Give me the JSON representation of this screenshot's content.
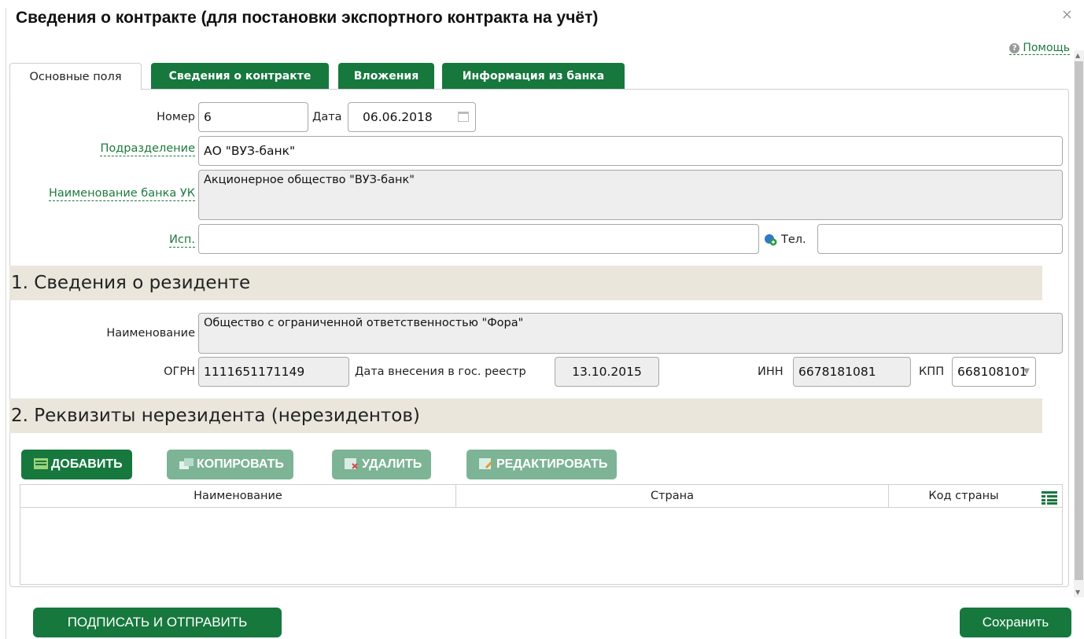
{
  "dialog": {
    "title": "Сведения о контракте (для постановки экспортного контракта на учёт)",
    "close": "×"
  },
  "help": {
    "label": "Помощь"
  },
  "tabs": [
    {
      "label": "Основные поля"
    },
    {
      "label": "Сведения о контракте"
    },
    {
      "label": "Вложения"
    },
    {
      "label": "Информация из банка"
    }
  ],
  "main": {
    "number_label": "Номер",
    "number_value": "6",
    "date_label": "Дата",
    "date_value": "06.06.2018",
    "division_label": "Подразделение",
    "division_value": "АО \"ВУЗ-банк\"",
    "bank_label": "Наименование банка УК",
    "bank_value": "Акционерное общество \"ВУЗ-банк\"",
    "executor_label": "Исп.",
    "executor_value": "",
    "phone_label": "Тел.",
    "phone_value": ""
  },
  "resident": {
    "section_title": "1. Сведения о резиденте",
    "name_label": "Наименование",
    "name_value": "Общество с ограниченной ответственностью \"Фора\"",
    "ogrn_label": "ОГРН",
    "ogrn_value": "1111651171149",
    "reg_date_label": "Дата внесения в гос. реестр",
    "reg_date_value": "13.10.2015",
    "inn_label": "ИНН",
    "inn_value": "6678181081",
    "kpp_label": "КПП",
    "kpp_value": "668108101"
  },
  "nonresident": {
    "section_title": "2. Реквизиты нерезидента (нерезидентов)",
    "buttons": {
      "add": "ДОБАВИТЬ",
      "copy": "КОПИРОВАТЬ",
      "delete": "УДАЛИТЬ",
      "edit": "РЕДАКТИРОВАТЬ"
    },
    "columns": [
      "Наименование",
      "Страна",
      "Код страны"
    ]
  },
  "footer": {
    "sign_send": "ПОДПИСАТЬ И ОТПРАВИТЬ",
    "save": "Сохранить"
  },
  "colors": {
    "accent": "#16783d",
    "accent_light": "#7cb495",
    "section_bg": "#eae6dc",
    "readonly_bg": "#eeeeee"
  }
}
